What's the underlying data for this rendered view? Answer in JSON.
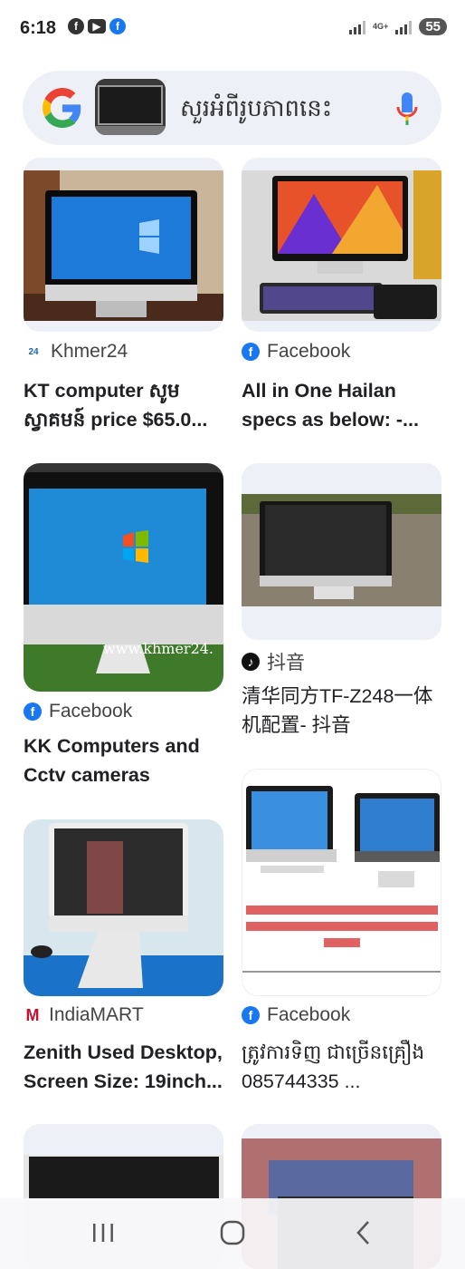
{
  "status_bar": {
    "time": "6:18",
    "notif_icons": [
      "facebook-icon",
      "youtube-icon",
      "facebook-icon"
    ],
    "network": "4G+",
    "battery": "55"
  },
  "search": {
    "query_text": "សួរអំពីរូបភាពនេះ",
    "icons": [
      "google-logo-icon",
      "mic-icon"
    ]
  },
  "results": [
    {
      "source": "Khmer24",
      "title": "KT computer សូម ស្វាគមន៍ price $65.0..."
    },
    {
      "source": "Facebook",
      "title": "All in One Hailan specs as below: -..."
    },
    {
      "source": "Facebook",
      "title": "KK Computers and Cctv cameras",
      "watermark": "www.khmer24."
    },
    {
      "source": "抖音",
      "title": "清华同方TF-Z248一体机配置- 抖音"
    },
    {
      "source": "IndiaMART",
      "title": "Zenith Used Desktop, Screen Size: 19inch..."
    },
    {
      "source": "Facebook",
      "title": "ត្រូវការទិញ ជាច្រើនគ្រឿង 085744335 ..."
    }
  ],
  "nav": {
    "icons": [
      "recent-apps-icon",
      "home-icon",
      "back-icon"
    ]
  },
  "colors": {
    "accent": "#1a73e8",
    "facebook": "#1877f2",
    "search_bg": "#eef0f8"
  }
}
